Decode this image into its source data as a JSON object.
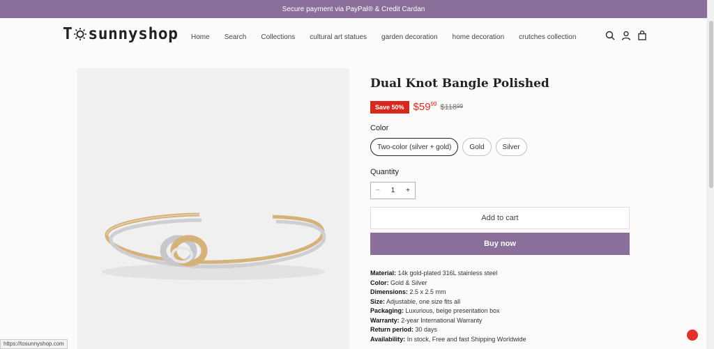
{
  "announcement": "Secure payment via PayPal® & Credit Cardan",
  "logo": {
    "prefix": "T",
    "suffix": "sunnyshop"
  },
  "nav": [
    "Home",
    "Search",
    "Collections",
    "cultural art statues",
    "garden decoration",
    "home decoration",
    "crutches collection"
  ],
  "header_icons": [
    "search-icon",
    "account-icon",
    "bag-icon"
  ],
  "product": {
    "title": "Dual Knot Bangle Polished",
    "save_badge": "Save 50%",
    "price_main": "$59",
    "price_cents": "99",
    "compare_main": "$118",
    "compare_cents": "99",
    "color_label": "Color",
    "colors": [
      "Two-color (silver + gold)",
      "Gold",
      "Silver"
    ],
    "selected_color": "Two-color (silver + gold)",
    "quantity_label": "Quantity",
    "quantity": "1",
    "minus": "−",
    "plus": "+",
    "add_to_cart": "Add to cart",
    "buy_now": "Buy now",
    "specs": [
      {
        "k": "Material:",
        "v": "14k gold-plated 316L stainless steel"
      },
      {
        "k": "Color:",
        "v": "Gold & Silver"
      },
      {
        "k": "Dimensions:",
        "v": "2.5 x 2.5 mm"
      },
      {
        "k": "Size:",
        "v": "Adjustable, one size fits all"
      },
      {
        "k": "Packaging:",
        "v": "Luxurious, beige presentation box"
      },
      {
        "k": "Warranty:",
        "v": "2-year International Warranty"
      },
      {
        "k": "Return period:",
        "v": "30 days"
      },
      {
        "k": "Availability:",
        "v": "In stock, Free and fast Shipping Worldwide"
      }
    ]
  },
  "status_url": "https://tosunnyshop.com",
  "colors": {
    "accent": "#8a6f9a",
    "sale": "#d8281e"
  }
}
